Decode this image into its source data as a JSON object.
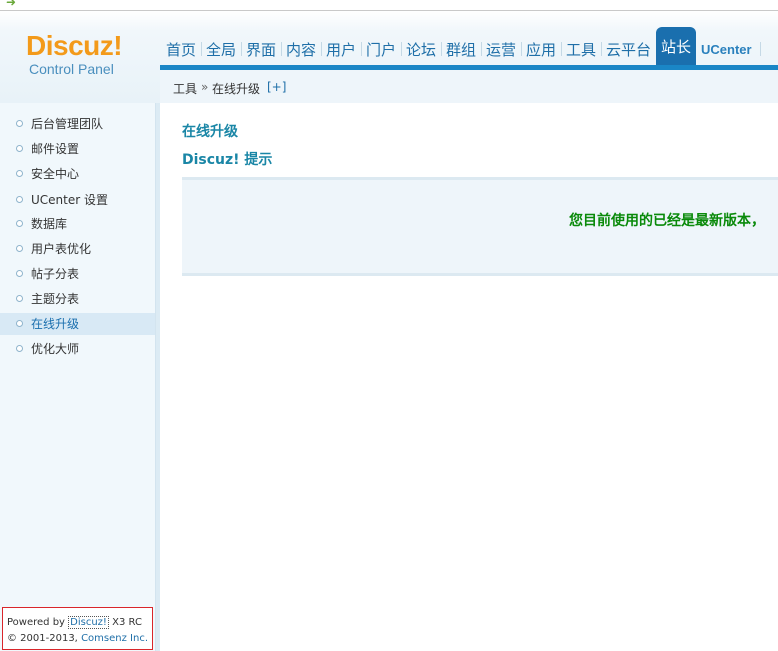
{
  "app": {
    "logo_brand": "Discuz!",
    "logo_sub": "Control Panel"
  },
  "nav": {
    "items": [
      "首页",
      "全局",
      "界面",
      "内容",
      "用户",
      "门户",
      "论坛",
      "群组",
      "运营",
      "应用",
      "工具",
      "云平台",
      "站长",
      "UCenter"
    ],
    "active_index": 12
  },
  "breadcrumb": {
    "parent": "工具",
    "separator": "»",
    "current": "在线升级",
    "add": "[+]"
  },
  "sidebar": {
    "items": [
      {
        "label": "后台管理团队"
      },
      {
        "label": "邮件设置"
      },
      {
        "label": "安全中心"
      },
      {
        "label": "UCenter 设置"
      },
      {
        "label": "数据库"
      },
      {
        "label": "用户表优化"
      },
      {
        "label": "帖子分表"
      },
      {
        "label": "主题分表"
      },
      {
        "label": "在线升级",
        "active": true
      },
      {
        "label": "优化大师"
      }
    ]
  },
  "footer": {
    "powered_by": "Powered by",
    "product": "Discuz!",
    "version": "X3 RC",
    "copyright": "© 2001-2013,",
    "company": "Comsenz Inc."
  },
  "main": {
    "title": "在线升级",
    "subtitle": "Discuz! 提示",
    "message": "您目前使用的已经是最新版本，"
  },
  "colors": {
    "accent": "#1a86c6",
    "nav_active": "#1a6fae",
    "logo": "#f39a1a",
    "success": "#0a8a0a"
  }
}
